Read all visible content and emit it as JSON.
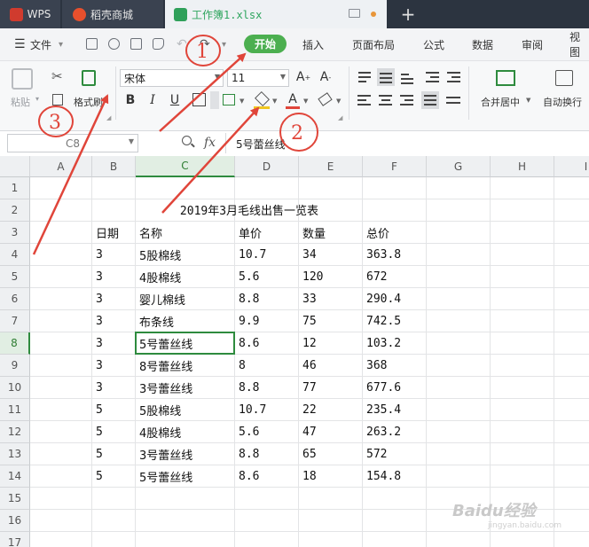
{
  "tabs": [
    {
      "id": "wps",
      "label": "WPS"
    },
    {
      "id": "store",
      "label": "稻壳商城"
    },
    {
      "id": "doc",
      "label": "工作簿1.xlsx"
    }
  ],
  "tab_plus": "+",
  "menu": {
    "file_label": "文件",
    "items": [
      "开始",
      "插入",
      "页面布局",
      "公式",
      "数据",
      "审阅",
      "视图"
    ]
  },
  "ribbon": {
    "paste_label": "粘贴",
    "format_painter_label": "格式刷",
    "font_name": "宋体",
    "font_size": "11",
    "bold": "B",
    "italic": "I",
    "underline": "U",
    "font_color_glyph": "A",
    "merge_label": "合并居中",
    "wrap_label": "自动换行"
  },
  "formula_bar": {
    "cell_ref": "C8",
    "fx": "fx",
    "value": "5号蕾丝线"
  },
  "sheet": {
    "columns": [
      "A",
      "B",
      "C",
      "D",
      "E",
      "F",
      "G",
      "H",
      "I"
    ],
    "row_numbers": [
      "1",
      "2",
      "3",
      "4",
      "5",
      "6",
      "7",
      "8",
      "9",
      "10",
      "11",
      "12",
      "13",
      "14",
      "15",
      "16",
      "17"
    ],
    "selected_column": "C",
    "selected_row": "8",
    "title": "2019年3月毛线出售一览表",
    "headers": [
      "日期",
      "名称",
      "单价",
      "数量",
      "总价"
    ],
    "rows": [
      [
        "3",
        "5股棉线",
        "10.7",
        "34",
        "363.8"
      ],
      [
        "3",
        "4股棉线",
        "5.6",
        "120",
        "672"
      ],
      [
        "3",
        "婴儿棉线",
        "8.8",
        "33",
        "290.4"
      ],
      [
        "3",
        "布条线",
        "9.9",
        "75",
        "742.5"
      ],
      [
        "3",
        "5号蕾丝线",
        "8.6",
        "12",
        "103.2"
      ],
      [
        "3",
        "8号蕾丝线",
        "8",
        "46",
        "368"
      ],
      [
        "3",
        "3号蕾丝线",
        "8.8",
        "77",
        "677.6"
      ],
      [
        "5",
        "5股棉线",
        "10.7",
        "22",
        "235.4"
      ],
      [
        "5",
        "4股棉线",
        "5.6",
        "47",
        "263.2"
      ],
      [
        "5",
        "3号蕾丝线",
        "8.8",
        "65",
        "572"
      ],
      [
        "5",
        "5号蕾丝线",
        "8.6",
        "18",
        "154.8"
      ]
    ]
  },
  "annotations": [
    "1",
    "2",
    "3"
  ],
  "watermark": {
    "text": "Baidu经验",
    "sub": "jingyan.baidu.com"
  },
  "colors": {
    "accent": "#4caf50",
    "selection": "#2e8b3e",
    "annotation": "#e0453a",
    "tabbar": "#2c3440"
  }
}
